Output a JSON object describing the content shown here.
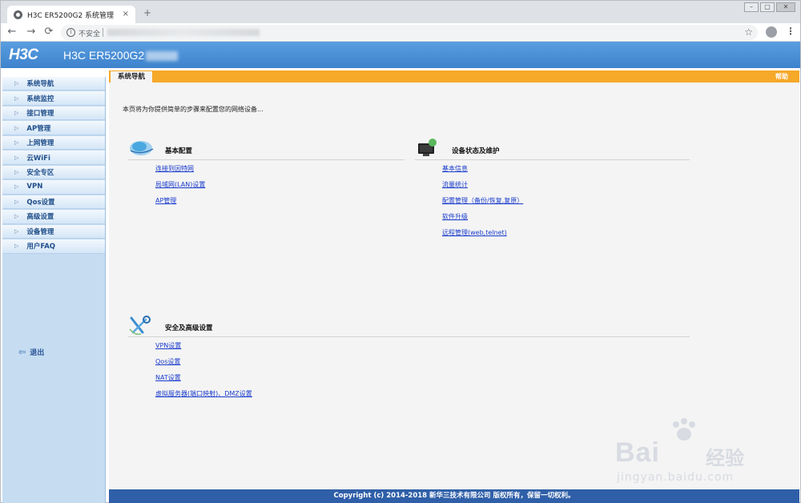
{
  "browser": {
    "tab_title": "H3C ER5200G2 系统管理",
    "tab_close": "×",
    "new_tab": "+",
    "back": "←",
    "forward": "→",
    "reload": "⟳",
    "insecure_label": "不安全",
    "bookmark": "☆",
    "menu": "⋮"
  },
  "header": {
    "logo": "H3C",
    "product": "H3C ER5200G2"
  },
  "sidebar": {
    "items": [
      {
        "label": "系统导航"
      },
      {
        "label": "系统监控"
      },
      {
        "label": "接口管理"
      },
      {
        "label": "AP管理"
      },
      {
        "label": "上网管理"
      },
      {
        "label": "云WiFi"
      },
      {
        "label": "安全专区"
      },
      {
        "label": "VPN"
      },
      {
        "label": "Qos设置"
      },
      {
        "label": "高级设置"
      },
      {
        "label": "设备管理"
      },
      {
        "label": "用户FAQ"
      }
    ],
    "logout": "退出"
  },
  "content": {
    "tab": "系统导航",
    "help": "帮助",
    "intro": "本页将为你提供简单的步骤来配置您的网络设备...",
    "sections": {
      "basic": {
        "title": "基本配置",
        "links": [
          "连接到因特网",
          "局域网(LAN)设置",
          "AP管理"
        ]
      },
      "status": {
        "title": "设备状态及维护",
        "links": [
          "基本信息",
          "流量统计",
          "配置管理（备份/恢复,复原）",
          "软件升级",
          "远程管理(web,telnet)"
        ]
      },
      "security": {
        "title": "安全及高级设置",
        "links": [
          "VPN设置",
          "Qos设置",
          "NAT设置",
          "虚拟服务器(端口映射)、DMZ设置"
        ]
      }
    }
  },
  "footer": {
    "copyright": "Copyright (c) 2014-2018 新华三技术有限公司 版权所有，保留一切权利。"
  },
  "watermark": {
    "brand": "Bai",
    "brand_cn": "经验",
    "url": "jingyan.baidu.com"
  },
  "colors": {
    "header_blue": "#3d82cc",
    "tab_orange": "#f6a829",
    "footer_blue": "#2f5fa8",
    "link_blue": "#1a3ccc"
  }
}
